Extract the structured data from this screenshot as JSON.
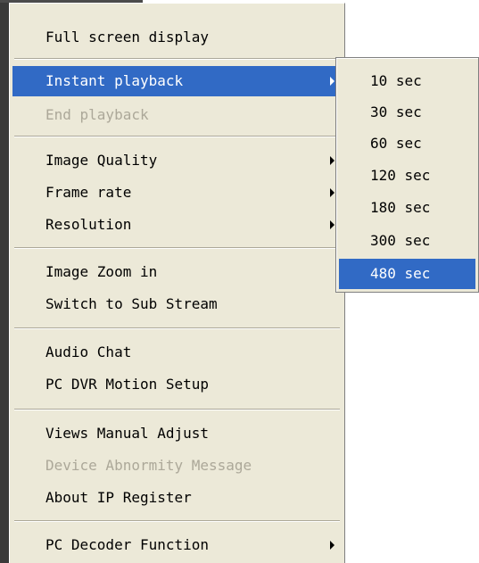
{
  "context_menu": {
    "items": [
      {
        "label": "Full screen display",
        "enabled": true
      },
      {
        "label": "Instant playback",
        "enabled": true,
        "selected": true,
        "has_submenu": true
      },
      {
        "label": "End playback",
        "enabled": false
      },
      {
        "label": "Image Quality",
        "enabled": true,
        "has_submenu": true
      },
      {
        "label": "Frame rate",
        "enabled": true,
        "has_submenu": true
      },
      {
        "label": "Resolution",
        "enabled": true,
        "has_submenu": true
      },
      {
        "label": "Image Zoom in",
        "enabled": true
      },
      {
        "label": "Switch to Sub Stream",
        "enabled": true
      },
      {
        "label": "Audio Chat",
        "enabled": true
      },
      {
        "label": "PC DVR Motion Setup",
        "enabled": true
      },
      {
        "label": "Views Manual Adjust",
        "enabled": true
      },
      {
        "label": "Device Abnormity Message",
        "enabled": false
      },
      {
        "label": "About IP Register",
        "enabled": true
      },
      {
        "label": "PC Decoder Function",
        "enabled": true,
        "has_submenu": true
      }
    ]
  },
  "playback_submenu": {
    "items": [
      {
        "label": "10 sec"
      },
      {
        "label": "30 sec"
      },
      {
        "label": "60 sec"
      },
      {
        "label": "120 sec"
      },
      {
        "label": "180 sec"
      },
      {
        "label": "300 sec"
      },
      {
        "label": "480 sec",
        "selected": true
      }
    ]
  },
  "colors": {
    "menu_bg": "#ece9d8",
    "highlight": "#316ac5",
    "disabled_text": "#aca899"
  }
}
